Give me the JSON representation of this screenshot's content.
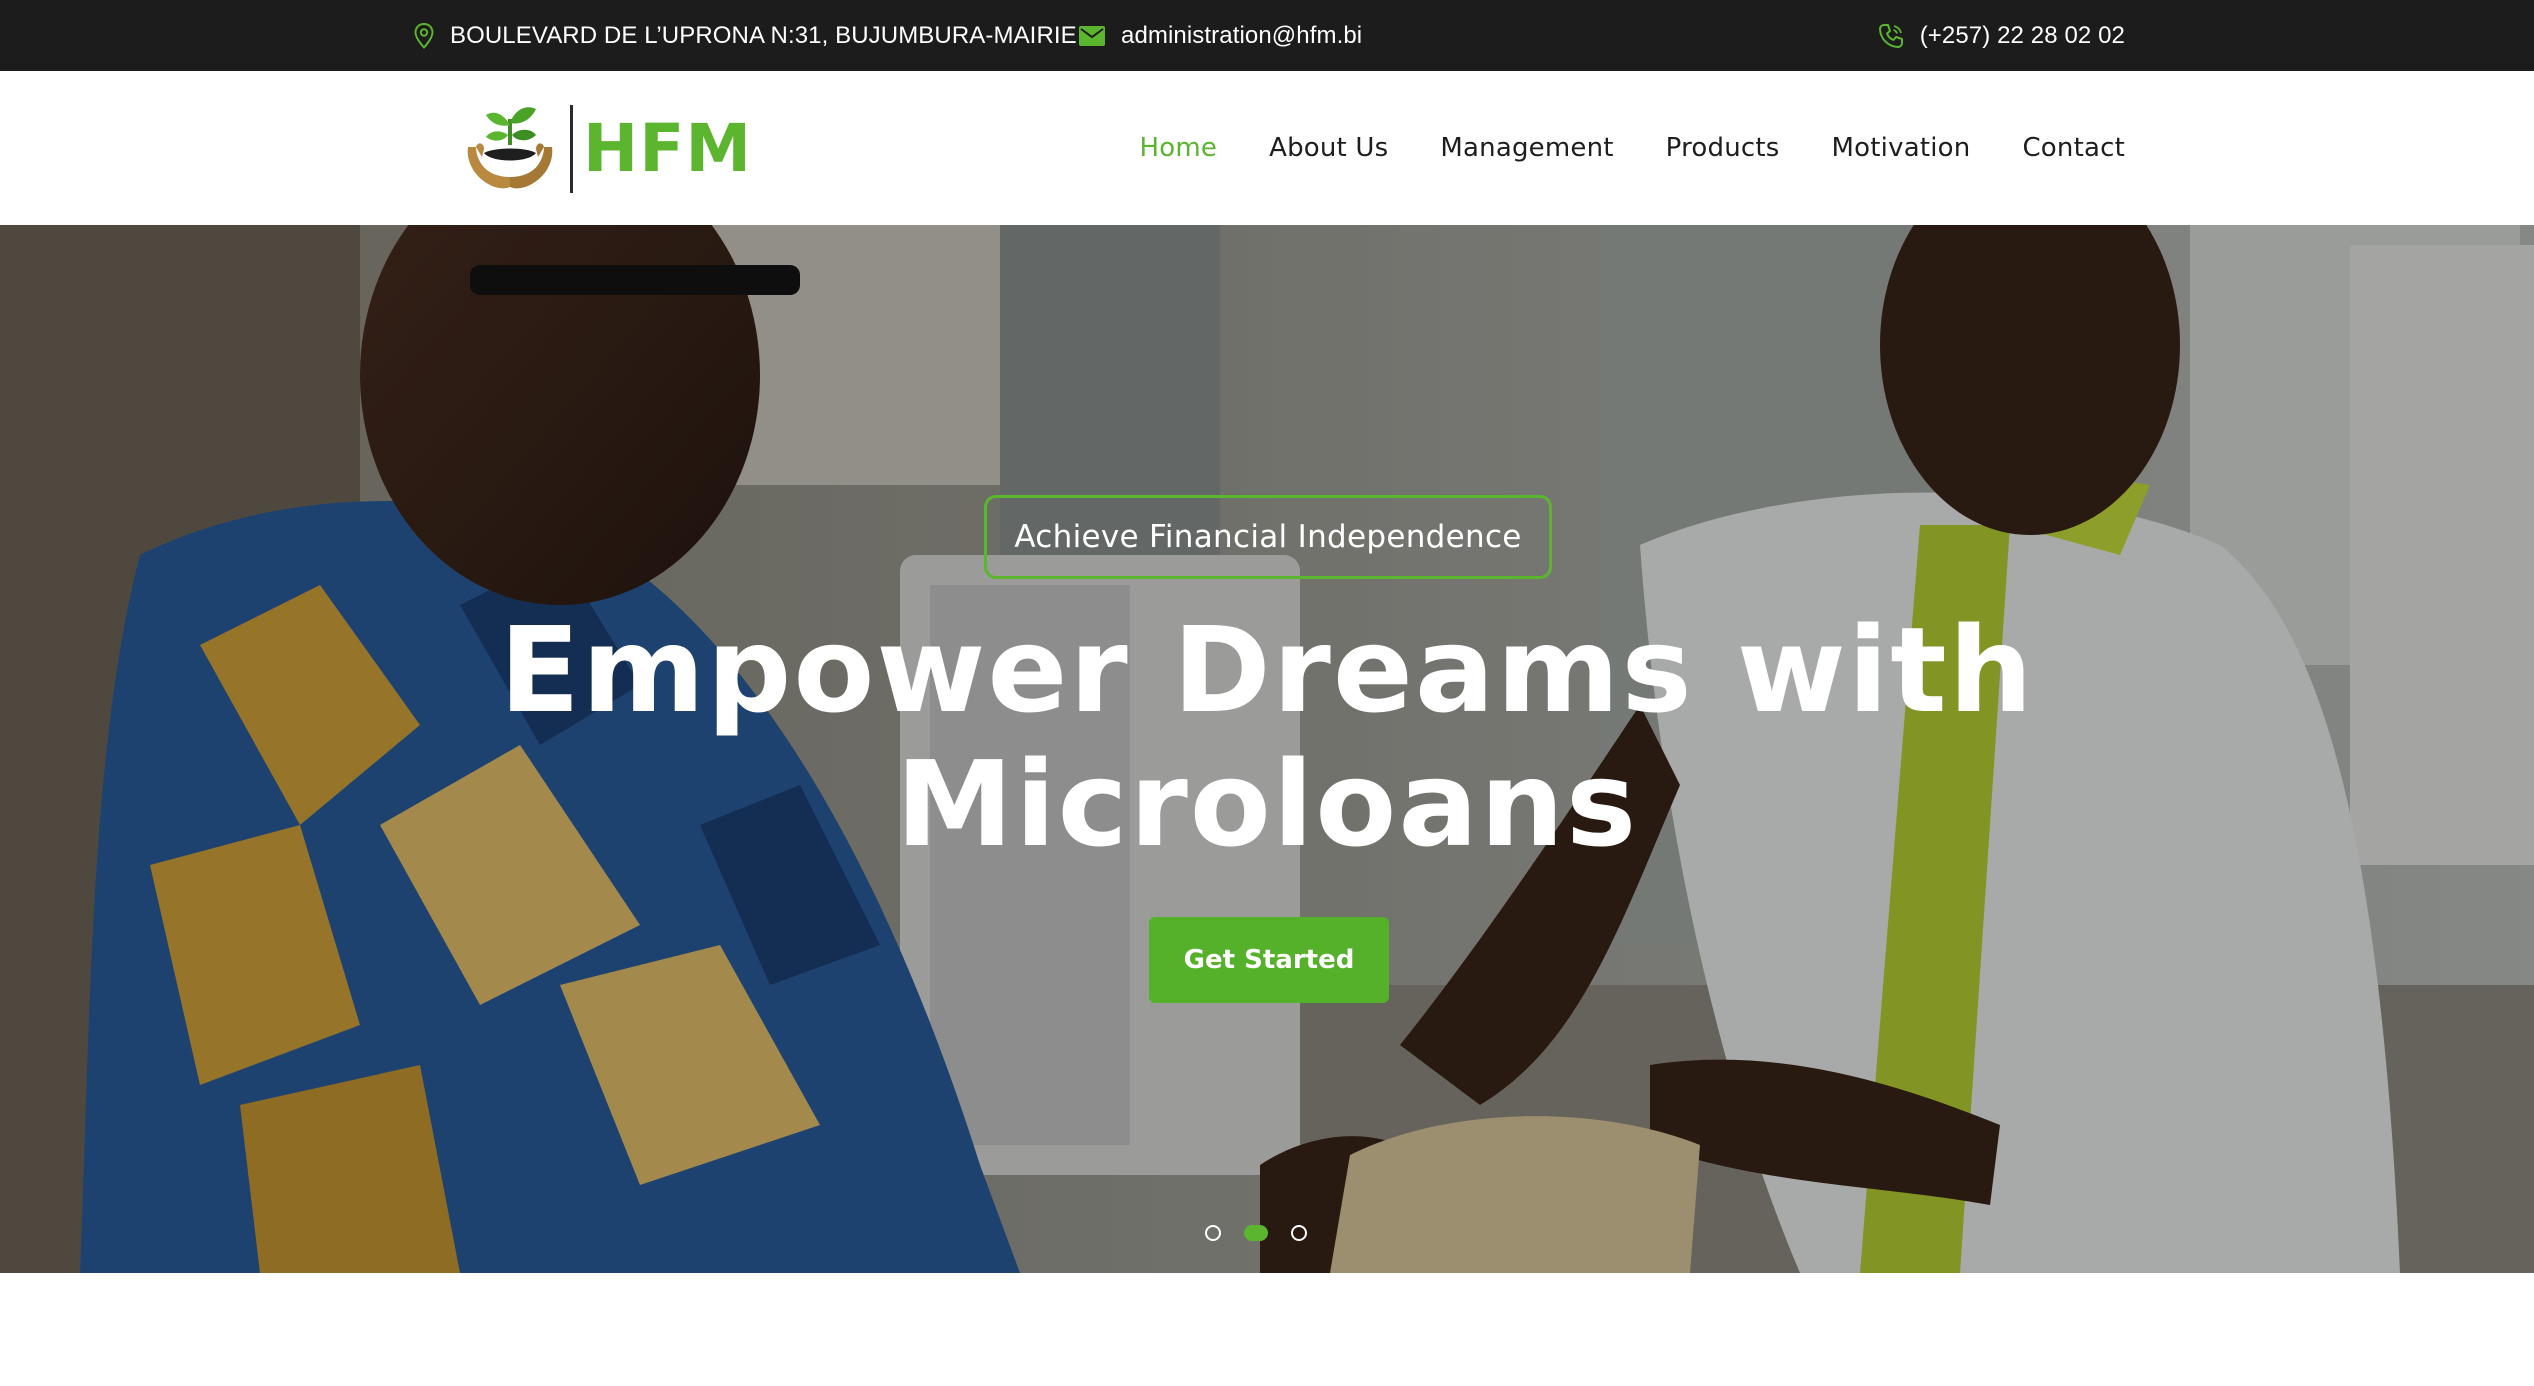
{
  "topbar": {
    "address": "BOULEVARD DE L’UPRONA N:31, BUJUMBURA-MAIRIE",
    "email": "administration@hfm.bi",
    "phone": "(+257) 22 28 02 02"
  },
  "brand": {
    "name": "HFM"
  },
  "nav": {
    "items": [
      {
        "label": "Home",
        "active": true
      },
      {
        "label": "About Us",
        "active": false
      },
      {
        "label": "Management",
        "active": false
      },
      {
        "label": "Products",
        "active": false
      },
      {
        "label": "Motivation",
        "active": false
      },
      {
        "label": "Contact",
        "active": false
      }
    ]
  },
  "hero": {
    "tagline": "Achieve Financial Independence",
    "title_line1": "Empower Dreams with",
    "title_line2": "Microloans",
    "cta_label": "Get Started",
    "slides": {
      "count": 3,
      "active_index": 1
    }
  },
  "colors": {
    "accent": "#5bb52f",
    "topbar_bg": "#1c1c1c",
    "text_dark": "#1e1e1e",
    "white": "#ffffff"
  },
  "icons": {
    "address": "map-pin-icon",
    "email": "envelope-icon",
    "phone": "phone-icon",
    "logo": "hands-with-sprout-logo"
  }
}
